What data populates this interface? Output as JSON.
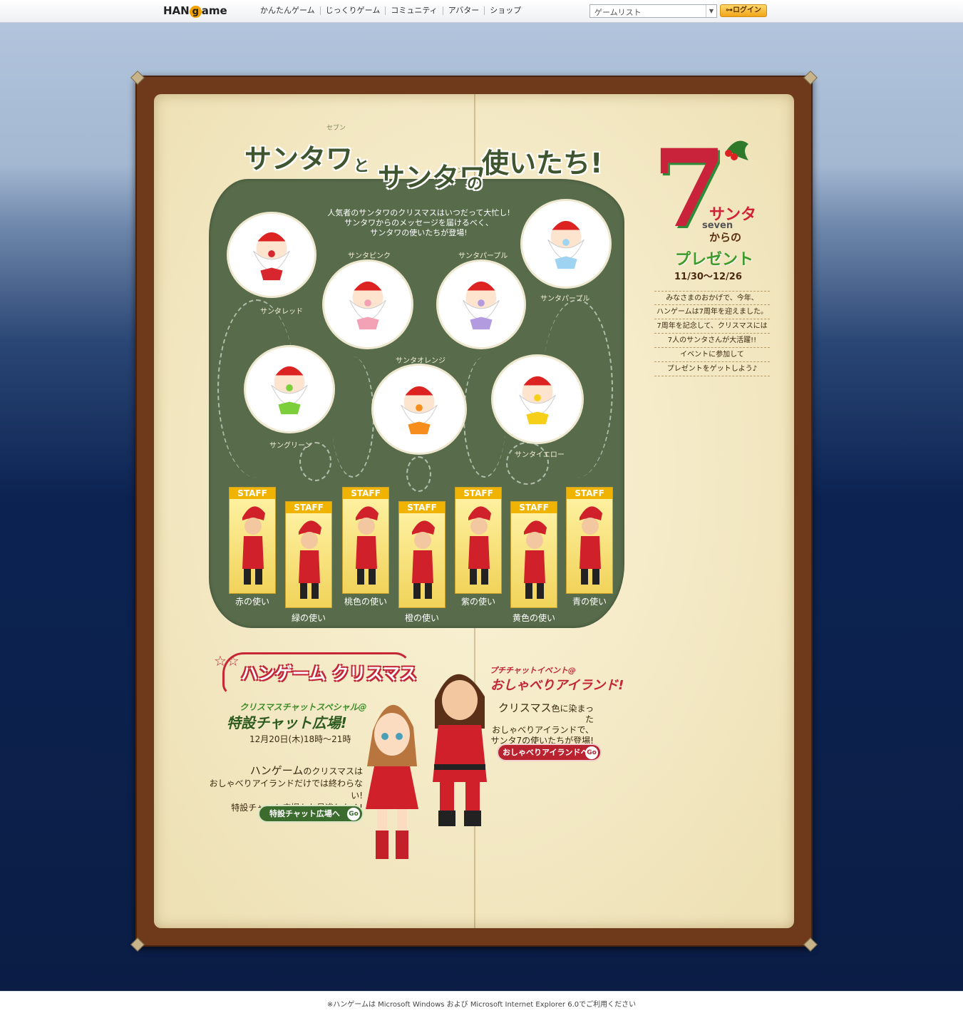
{
  "header": {
    "logo_prefix": "HAN",
    "logo_o": "g",
    "logo_suffix": "ame",
    "nav": [
      "かんたんゲーム",
      "じっくりゲーム",
      "コミュニティ",
      "アバター",
      "ショップ"
    ],
    "gamelist": "ゲームリスト",
    "login": "ログイン"
  },
  "book": {
    "title": {
      "part1": "サンタワ",
      "and": "と",
      "part2": "サンタワ",
      "no": "の",
      "part3": "使いたち!",
      "ruby1": "セブン",
      "ruby2": "セブン"
    },
    "intro": [
      "人気者のサンタワのクリスマスはいつだって大忙し!",
      "サンタワからのメッセージを届けるべく、",
      "サンタワの使いたちが登場!"
    ],
    "santas": [
      {
        "name": "サンタレッド",
        "color": "#d8262e"
      },
      {
        "name": "サンタピンク",
        "color": "#f3a2b5"
      },
      {
        "name": "サンタパープル",
        "color": "#b39be0"
      },
      {
        "name": "サンタパープル",
        "color": "#9fd3f2"
      },
      {
        "name": "サングリーン",
        "color": "#7ccf3a"
      },
      {
        "name": "サンタオレンジ",
        "color": "#f78d1c"
      },
      {
        "name": "サンタイエロー",
        "color": "#f6cf18"
      }
    ],
    "messengers": [
      "赤の使い",
      "緑の使い",
      "桃色の使い",
      "橙の使い",
      "紫の使い",
      "黄色の使い",
      "青の使い"
    ],
    "staff": "STAFF",
    "side": {
      "seven": "7",
      "santa": "サンタ",
      "seven_en": "seven",
      "kara": "からの",
      "present": "プレゼント",
      "date": "11/30〜12/26",
      "message": [
        "みなさまのおかげで、今年、",
        "ハンゲームは7周年を迎えました。",
        "7周年を記念して、クリスマスには",
        "7人のサンタさんが大活躍!!",
        "イベントに参加して",
        "プレゼントをゲットしよう♪"
      ]
    },
    "xmas": {
      "title": "ハンゲーム クリスマス",
      "chat_sub": "クリスマスチャットスペシャル@",
      "chat_title": "特設チャット広場!",
      "chat_date": "12月20日(木)18時〜21時",
      "text_big": "ハンゲーム",
      "text_small": "のクリスマスは",
      "text2": "おしゃべりアイランドだけでは終わらない!",
      "text3": "特設チャット広場もお見逃しなく!",
      "btn_chat": "特設チャット広場へ",
      "go": "Go"
    },
    "island": {
      "sub": "プチチャットイベント@",
      "title": "おしゃべりアイランド!",
      "text_big": "クリスマス",
      "text_small": "色に染まった",
      "text2": "おしゃべりアイランドで、",
      "text3": "サンタ7の使いたちが登場!",
      "btn": "おしゃべりアイランドへ",
      "go": "Go"
    }
  },
  "footer": "※ハンゲームは Microsoft Windows および Microsoft Internet Explorer 6.0でご利用ください"
}
